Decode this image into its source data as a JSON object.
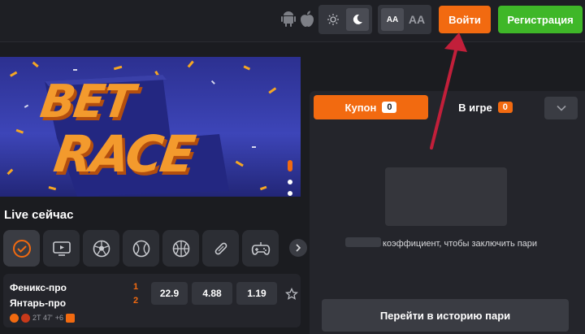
{
  "header": {
    "os_icons": [
      "android-icon",
      "apple-icon"
    ],
    "theme_toggle": {
      "light_icon": "sun-icon",
      "dark_icon": "moon-icon",
      "selected": "dark"
    },
    "font_size_toggle": {
      "small_label": "AA",
      "large_label": "AA",
      "selected": "small"
    },
    "login_label": "Войти",
    "register_label": "Регистрация"
  },
  "banner": {
    "line1": "BET",
    "line2": "RACE",
    "slides_total": 3,
    "slides_current": 1
  },
  "live": {
    "title": "Live сейчас",
    "sports": [
      {
        "icon": "check-circle-icon",
        "active": true
      },
      {
        "icon": "tv-icon",
        "active": false
      },
      {
        "icon": "soccer-ball-icon",
        "active": false
      },
      {
        "icon": "tennis-ball-icon",
        "active": false
      },
      {
        "icon": "basketball-icon",
        "active": false
      },
      {
        "icon": "hockey-stick-icon",
        "active": false
      },
      {
        "icon": "gamepad-icon",
        "active": false
      }
    ],
    "match": {
      "team1": "Феникс-про",
      "team2": "Янтарь-про",
      "team1_seq": "1",
      "team2_seq": "2",
      "odds": [
        "22.9",
        "4.88",
        "1.19"
      ],
      "period": "2Т 47'",
      "more": "+6"
    }
  },
  "coupon": {
    "tab_coupon_label": "Купон",
    "tab_coupon_count": "0",
    "tab_ingame_label": "В игре",
    "tab_ingame_count": "0",
    "hint_text": "коэффициент, чтобы заключить пари",
    "history_button_label": "Перейти в историю пари"
  },
  "colors": {
    "accent_orange": "#f26a10",
    "register_green": "#3fb728",
    "background": "#1b1c20",
    "arrow_red": "#c21f3a"
  }
}
